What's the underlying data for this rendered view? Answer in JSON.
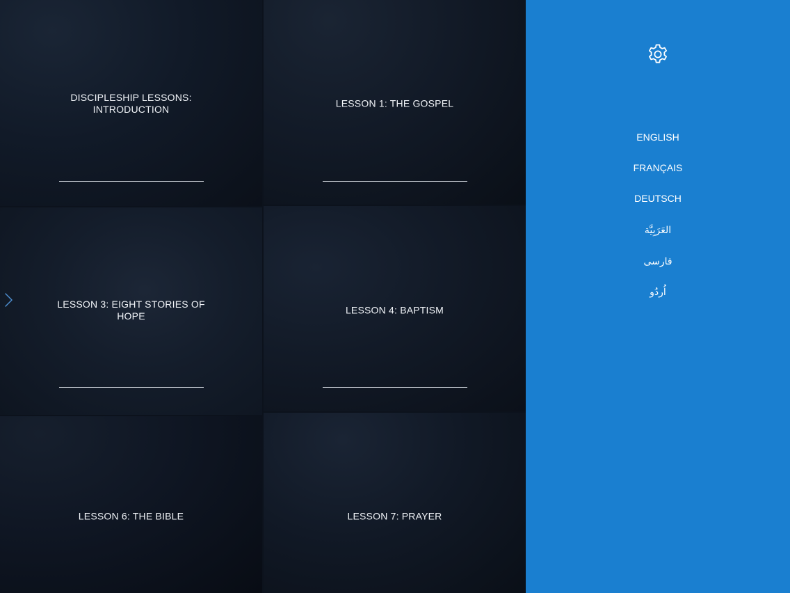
{
  "lessons": [
    {
      "title": "DISCIPLESHIP LESSONS: INTRODUCTION"
    },
    {
      "title": "LESSON 1: THE GOSPEL"
    },
    {
      "title": "LESSON 3: EIGHT STORIES OF HOPE"
    },
    {
      "title": "LESSON 4: BAPTISM"
    },
    {
      "title": "LESSON 6: THE BIBLE"
    },
    {
      "title": "LESSON 7: PRAYER"
    }
  ],
  "sidebar": {
    "settings_icon": "gear-icon",
    "languages": [
      {
        "label": "ENGLISH"
      },
      {
        "label": "FRANÇAIS"
      },
      {
        "label": "DEUTSCH"
      },
      {
        "label": "العَرَبِيَّة"
      },
      {
        "label": "فارسی"
      },
      {
        "label": "اُردُو"
      }
    ]
  },
  "colors": {
    "sidebar_bg": "#1a7fd0",
    "tile_bg": "#101826",
    "text": "#f1f4f8",
    "chevron": "#4d8ed0"
  },
  "icons": {
    "left_edge": "chevron-right-icon",
    "settings": "gear-icon"
  }
}
